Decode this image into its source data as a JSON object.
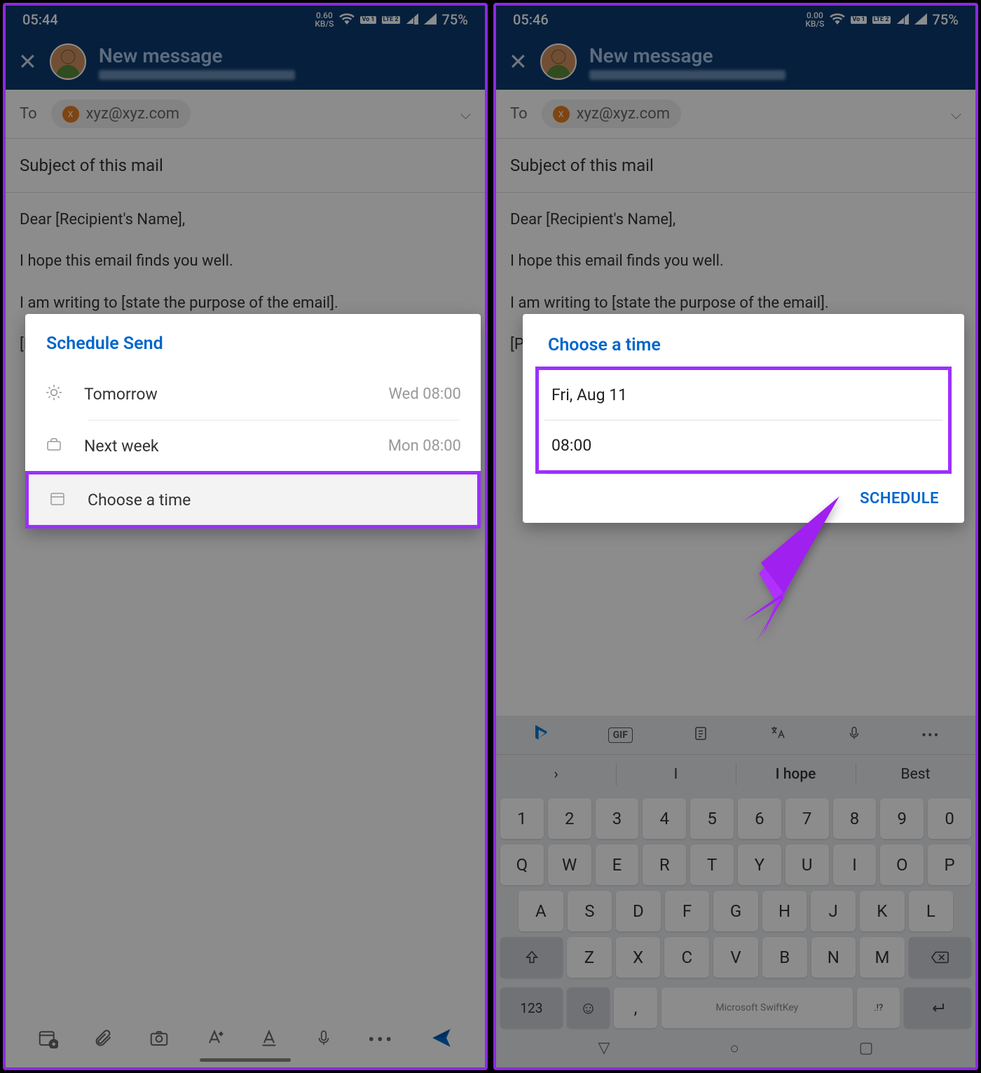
{
  "left": {
    "status": {
      "time": "05:44",
      "kbs": "0.60",
      "kbs_unit": "KB/S",
      "lte1": "Vo 1",
      "lte2": "LTE 2",
      "battery": "75%"
    },
    "header": {
      "title": "New message"
    },
    "to_label": "To",
    "recipient": "xyz@xyz.com",
    "subject": "Subject of this mail",
    "body_lines": [
      "Dear [Recipient's Name],",
      "I hope this email finds you well.",
      "I am writing to [state the purpose of the email].",
      "[Provide more details, an explanation, or any"
    ],
    "dialog": {
      "title": "Schedule Send",
      "opts": [
        {
          "label": "Tomorrow",
          "time": "Wed 08:00"
        },
        {
          "label": "Next week",
          "time": "Mon 08:00"
        },
        {
          "label": "Choose a time",
          "time": ""
        }
      ]
    }
  },
  "right": {
    "status": {
      "time": "05:46",
      "kbs": "0.00",
      "kbs_unit": "KB/S",
      "lte1": "Vo 1",
      "lte2": "LTE 2",
      "battery": "75%"
    },
    "header": {
      "title": "New message"
    },
    "to_label": "To",
    "recipient": "xyz@xyz.com",
    "subject": "Subject of this mail",
    "body_lines": [
      "Dear [Recipient's Name],",
      "I hope this email finds you well.",
      "I am writing to [state the purpose of the email].",
      "[Provide more details, an explanation, or any"
    ],
    "dialog": {
      "title": "Choose a time",
      "date": "Fri, Aug 11",
      "time": "08:00",
      "btn": "SCHEDULE"
    },
    "suggestions": [
      "",
      "I",
      "I hope",
      "Best"
    ],
    "keys_num": [
      "1",
      "2",
      "3",
      "4",
      "5",
      "6",
      "7",
      "8",
      "9",
      "0"
    ],
    "keys_r1": [
      "Q",
      "W",
      "E",
      "R",
      "T",
      "Y",
      "U",
      "I",
      "O",
      "P"
    ],
    "keys_r2": [
      "A",
      "S",
      "D",
      "F",
      "G",
      "H",
      "J",
      "K",
      "L"
    ],
    "keys_r3": [
      "Z",
      "X",
      "C",
      "V",
      "B",
      "N",
      "M"
    ],
    "kb_123": "123",
    "kb_space": "Microsoft SwiftKey",
    "kb_punct": ".!?"
  }
}
